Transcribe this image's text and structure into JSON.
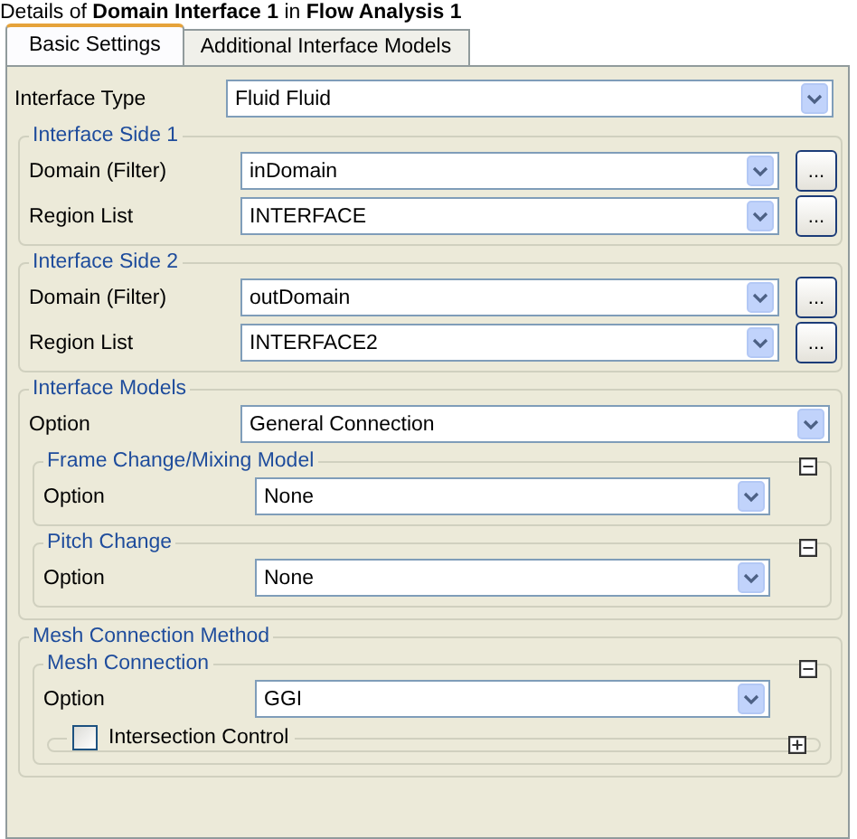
{
  "header": "Details of **Domain Interface 1** in **Flow Analysis 1**",
  "tabs": [
    {
      "label": "Basic Settings",
      "selected": true
    },
    {
      "label": "Additional Interface Models",
      "selected": false
    }
  ],
  "items": [
    {
      "kind": "field",
      "label": "Interface Type",
      "value": "Fluid Fluid"
    },
    {
      "kind": "group",
      "title": "Interface Side 1",
      "children": [
        {
          "kind": "field",
          "label": "Domain (Filter)",
          "value": "inDomain",
          "button": "..."
        },
        {
          "kind": "field",
          "label": "Region List",
          "value": "INTERFACE",
          "button": "..."
        }
      ]
    },
    {
      "kind": "group",
      "title": "Interface Side 2",
      "children": [
        {
          "kind": "field",
          "label": "Domain (Filter)",
          "value": "outDomain",
          "button": "..."
        },
        {
          "kind": "field",
          "label": "Region List",
          "value": "INTERFACE2",
          "button": "..."
        }
      ]
    },
    {
      "kind": "group",
      "title": "Interface Models",
      "children": [
        {
          "kind": "field",
          "label": "Option",
          "value": "General Connection"
        },
        {
          "kind": "group",
          "title": "Frame Change/Mixing Model",
          "expanded": true,
          "children": [
            {
              "kind": "field",
              "label": "Option",
              "value": "None"
            }
          ]
        },
        {
          "kind": "group",
          "title": "Pitch Change",
          "expanded": true,
          "children": [
            {
              "kind": "field",
              "label": "Option",
              "value": "None"
            }
          ]
        }
      ]
    },
    {
      "kind": "group",
      "title": "Mesh Connection Method",
      "children": [
        {
          "kind": "group",
          "title": "Mesh Connection",
          "expanded": true,
          "children": [
            {
              "kind": "field",
              "label": "Option",
              "value": "GGI"
            },
            {
              "kind": "check-group",
              "label": "Intersection Control",
              "checked": false,
              "expanded": false
            }
          ]
        }
      ]
    }
  ]
}
